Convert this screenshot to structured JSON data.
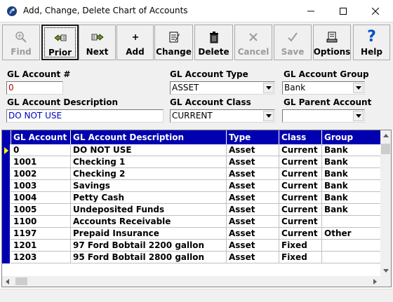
{
  "window": {
    "title": "Add, Change, Delete Chart of Accounts",
    "icon": "app-logo-icon"
  },
  "toolbar": {
    "buttons": [
      {
        "label": "Find",
        "icon": "find-icon",
        "disabled": true
      },
      {
        "label": "Prior",
        "icon": "prior-icon",
        "disabled": false,
        "pressed": true
      },
      {
        "label": "Next",
        "icon": "next-icon",
        "disabled": false
      },
      {
        "label": "Add",
        "icon": "add-icon",
        "disabled": false
      },
      {
        "label": "Change",
        "icon": "change-icon",
        "disabled": false
      },
      {
        "label": "Delete",
        "icon": "delete-icon",
        "disabled": false
      },
      {
        "label": "Cancel",
        "icon": "cancel-icon",
        "disabled": true
      },
      {
        "label": "Save",
        "icon": "save-icon",
        "disabled": true
      },
      {
        "label": "Options",
        "icon": "options-icon",
        "disabled": false
      },
      {
        "label": "Help",
        "icon": "help-icon",
        "disabled": false
      }
    ]
  },
  "form": {
    "account_number_label": "GL Account #",
    "account_number_value": "0",
    "account_type_label": "GL Account Type",
    "account_type_value": "ASSET",
    "account_group_label": "GL Account Group",
    "account_group_value": "Bank",
    "description_label": "GL Account Description",
    "description_value": "DO NOT USE",
    "account_class_label": "GL Account Class",
    "account_class_value": "CURRENT",
    "parent_account_label": "GL Parent Account",
    "parent_account_value": ""
  },
  "grid": {
    "columns": [
      "GL Account #",
      "GL Account Description",
      "Type",
      "Class",
      "Group"
    ],
    "rows": [
      [
        "0",
        "DO NOT USE",
        "Asset",
        "Current",
        "Bank"
      ],
      [
        "1001",
        "Checking 1",
        "Asset",
        "Current",
        "Bank"
      ],
      [
        "1002",
        "Checking 2",
        "Asset",
        "Current",
        "Bank"
      ],
      [
        "1003",
        "Savings",
        "Asset",
        "Current",
        "Bank"
      ],
      [
        "1004",
        "Petty Cash",
        "Asset",
        "Current",
        "Bank"
      ],
      [
        "1005",
        "Undeposited Funds",
        "Asset",
        "Current",
        "Bank"
      ],
      [
        "1100",
        "Accounts Receivable",
        "Asset",
        "Current",
        ""
      ],
      [
        "1197",
        "Prepaid Insurance",
        "Asset",
        "Current",
        "Other"
      ],
      [
        "1201",
        "97 Ford Bobtail 2200 gallon",
        "Asset",
        "Fixed",
        ""
      ],
      [
        "1203",
        "95 Ford Bobtail 2800 gallon",
        "Asset",
        "Fixed",
        ""
      ]
    ],
    "selected_row": 0
  },
  "colors": {
    "header_bg": "#0000b0",
    "account_number_text": "#c00000",
    "description_text": "#0000c0",
    "indicator_arrow": "#ffff00"
  }
}
